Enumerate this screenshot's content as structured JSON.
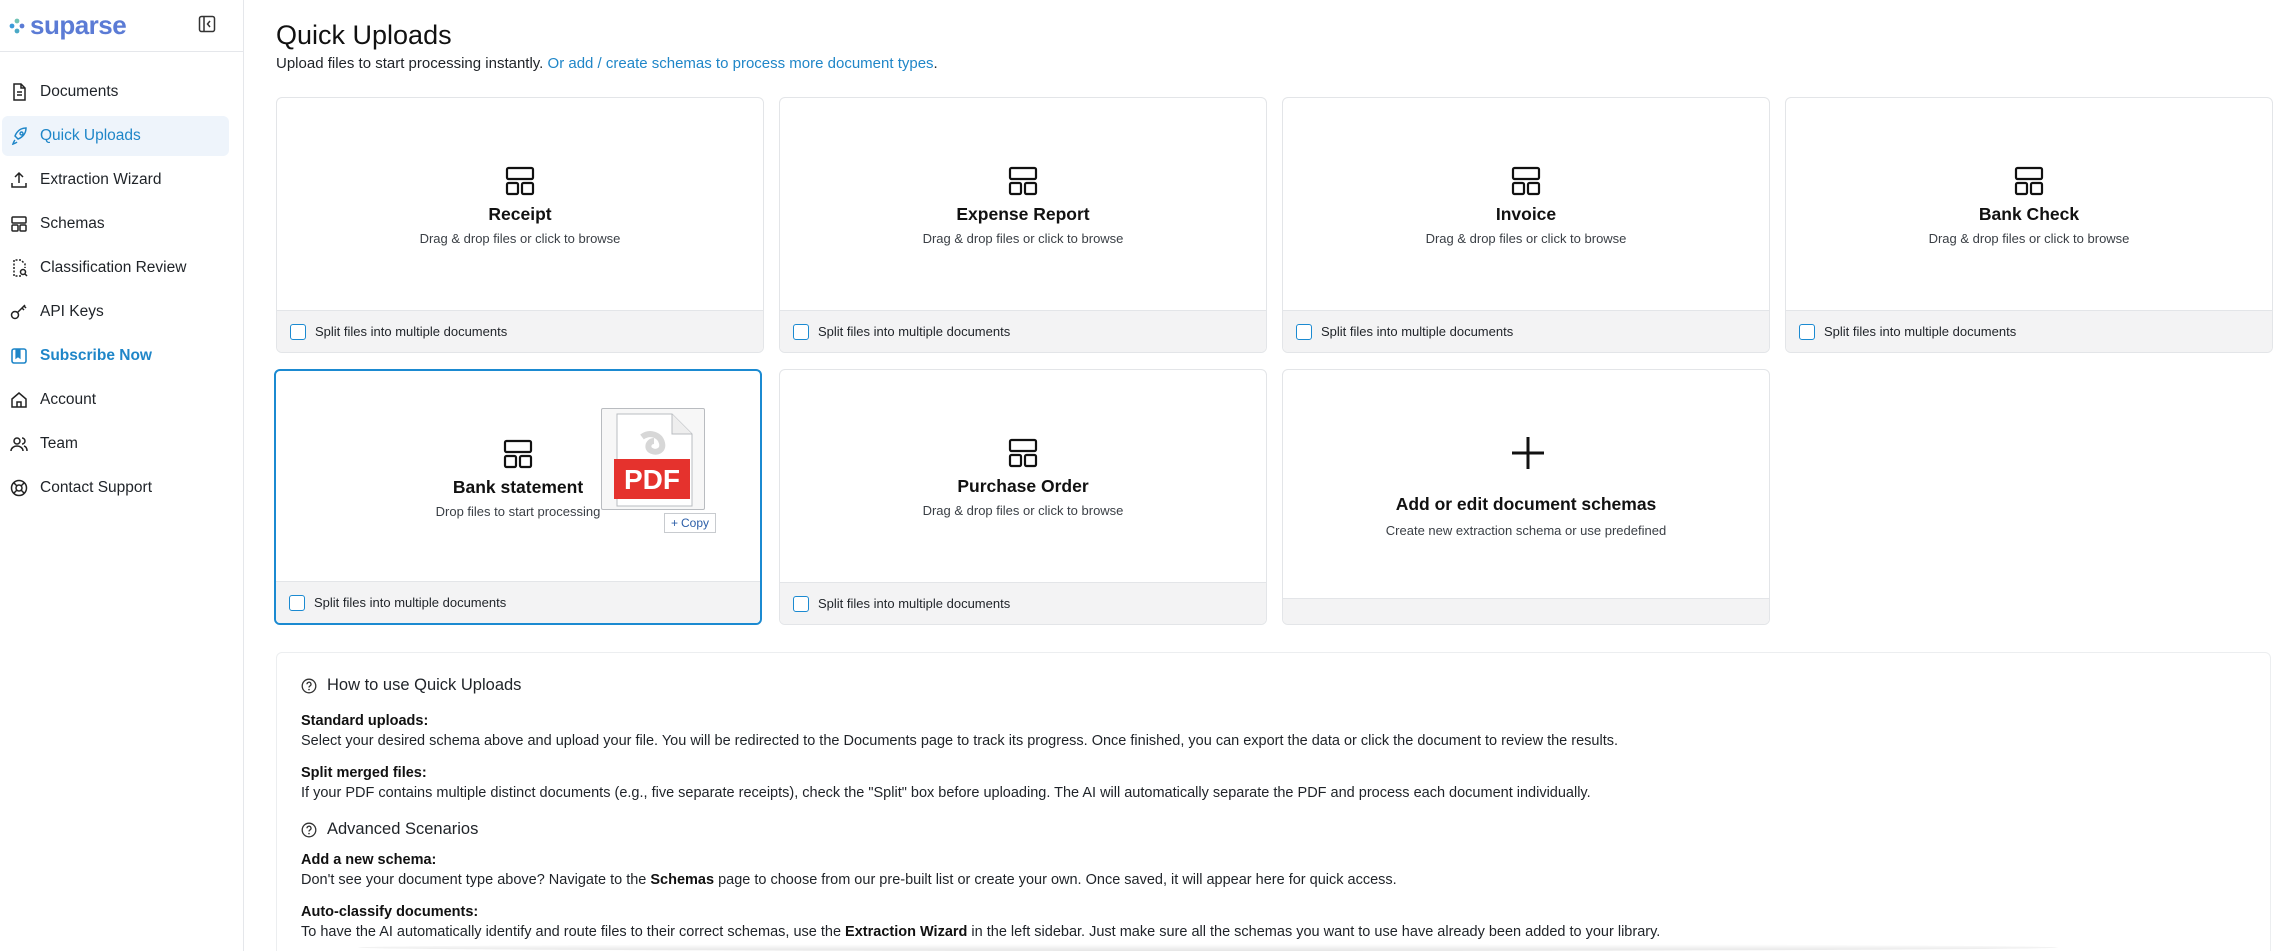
{
  "brand": {
    "name": "suparse"
  },
  "sidebar": {
    "items": [
      {
        "label": "Documents"
      },
      {
        "label": "Quick Uploads"
      },
      {
        "label": "Extraction Wizard"
      },
      {
        "label": "Schemas"
      },
      {
        "label": "Classification Review"
      },
      {
        "label": "API Keys"
      },
      {
        "label": "Subscribe Now"
      },
      {
        "label": "Account"
      },
      {
        "label": "Team"
      },
      {
        "label": "Contact Support"
      }
    ],
    "active": "Quick Uploads"
  },
  "header": {
    "title": "Quick Uploads",
    "subtitle_text": "Upload files to start processing instantly. ",
    "subtitle_link": "Or add / create schemas to process more document types",
    "subtitle_end": "."
  },
  "cards": [
    {
      "title": "Receipt",
      "hint": "Drag & drop files or click to browse",
      "split_label": "Split files into multiple documents"
    },
    {
      "title": "Expense Report",
      "hint": "Drag & drop files or click to browse",
      "split_label": "Split files into multiple documents"
    },
    {
      "title": "Invoice",
      "hint": "Drag & drop files or click to browse",
      "split_label": "Split files into multiple documents"
    },
    {
      "title": "Bank Check",
      "hint": "Drag & drop files or click to browse",
      "split_label": "Split files into multiple documents"
    },
    {
      "title": "Bank statement",
      "hint": "Drop files to start processing",
      "split_label": "Split files into multiple documents"
    },
    {
      "title": "Purchase Order",
      "hint": "Drag & drop files or click to browse",
      "split_label": "Split files into multiple documents"
    }
  ],
  "add_card": {
    "title": "Add or edit document schemas",
    "hint": "Create new extraction schema or use predefined"
  },
  "drag_preview": {
    "file_label": "PDF",
    "copy_label": "Copy"
  },
  "help": {
    "heading1": "How to use Quick Uploads",
    "standard_title": "Standard uploads:",
    "standard_text": "Select your desired schema above and upload your file. You will be redirected to the Documents page to track its progress. Once finished, you can export the data or click the document to review the results.",
    "split_title": "Split merged files:",
    "split_text": "If your PDF contains multiple distinct documents (e.g., five separate receipts), check the \"Split\" box before uploading. The AI will automatically separate the PDF and process each document individually.",
    "heading2": "Advanced Scenarios",
    "schema_title": "Add a new schema:",
    "schema_text_1": "Don't see your document type above? Navigate to the ",
    "schema_text_bold": "Schemas",
    "schema_text_2": " page to choose from our pre-built list or create your own. Once saved, it will appear here for quick access.",
    "classify_title": "Auto-classify documents:",
    "classify_text_1": "To have the AI automatically identify and route files to their correct schemas, use the ",
    "classify_text_bold": "Extraction Wizard",
    "classify_text_2": " in the left sidebar. Just make sure all the schemas you want to use have already been added to your library."
  },
  "colors": {
    "accent": "#1b8ad1",
    "brand": "#5b7bd5",
    "pdf_red": "#e5322d"
  }
}
